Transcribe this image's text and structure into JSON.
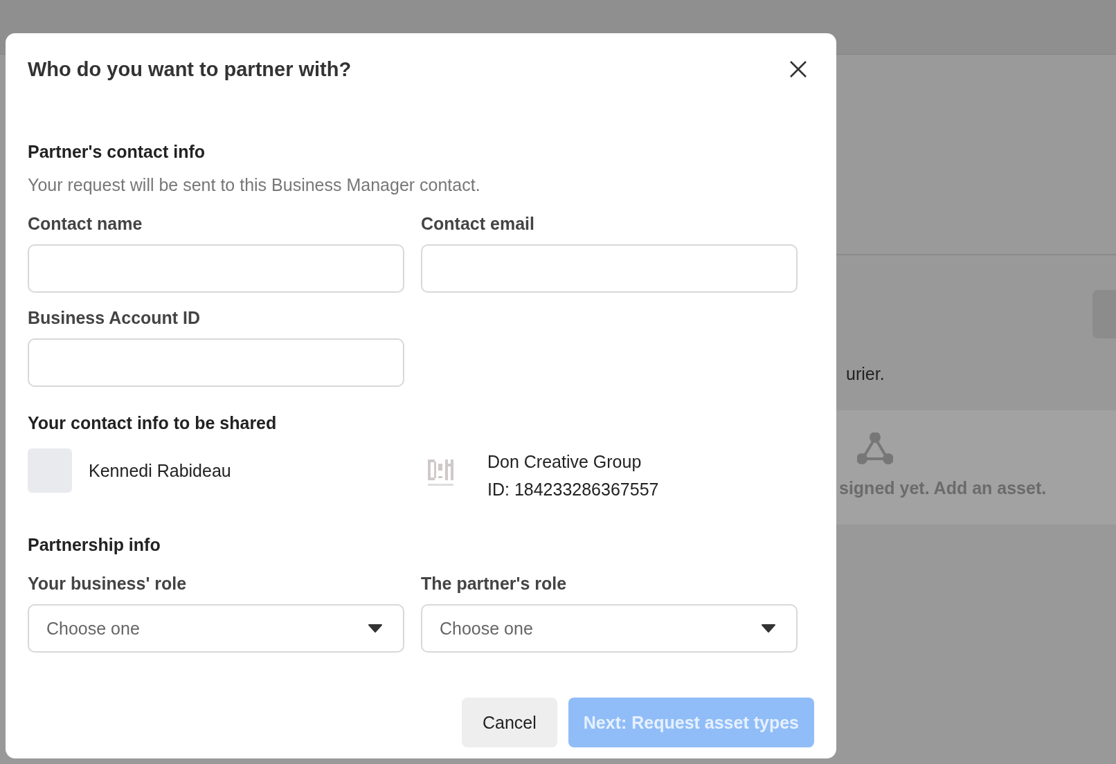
{
  "background": {
    "texts": [
      "urier.",
      "signed yet. Add an asset."
    ]
  },
  "dialog": {
    "title": "Who do you want to partner with?",
    "partner_section": {
      "heading": "Partner's contact info",
      "description": "Your request will be sent to this Business Manager contact.",
      "fields": [
        {
          "label": "Contact name"
        },
        {
          "label": "Contact email"
        },
        {
          "label": "Business Account ID"
        }
      ]
    },
    "shared_section": {
      "heading": "Your contact info to be shared",
      "person": {
        "name": "Kennedi Rabideau"
      },
      "business": {
        "name": "Don Creative Group",
        "id": "ID: 184233286367557"
      }
    },
    "partnership_section": {
      "heading": "Partnership info",
      "selects": [
        {
          "label": "Your business' role",
          "placeholder": "Choose one"
        },
        {
          "label": "The partner's role",
          "placeholder": "Choose one"
        }
      ]
    },
    "buttons": [
      {
        "label": "Cancel",
        "kind": "secondary",
        "disabled": false
      },
      {
        "label": "Next: Request asset types",
        "kind": "primary",
        "disabled": true
      }
    ]
  }
}
